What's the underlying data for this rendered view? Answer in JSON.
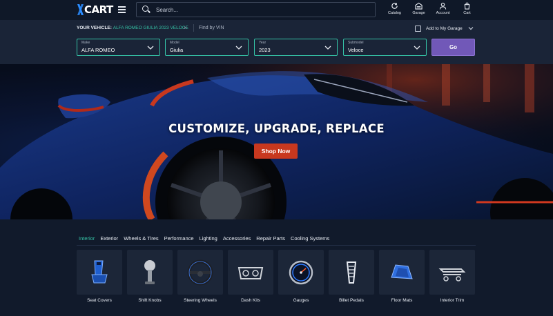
{
  "header": {
    "logo_text": "CART",
    "search_placeholder": "Search...",
    "nav": [
      {
        "label": "Catalog",
        "icon": "catalog-icon"
      },
      {
        "label": "Garage",
        "icon": "garage-icon"
      },
      {
        "label": "Account",
        "icon": "account-icon"
      },
      {
        "label": "Cart",
        "icon": "cart-icon"
      }
    ]
  },
  "vehicle": {
    "your_vehicle_label": "YOUR VEHICLE:",
    "your_vehicle_value": "ALFA ROMEO GIULIA 2023 VELOCE",
    "clear_symbol": "×",
    "find_by_vin": "Find by VIN",
    "add_to_garage": "Add to My Garage",
    "selects": [
      {
        "label": "Make",
        "value": "ALFA ROMEO"
      },
      {
        "label": "Model",
        "value": "Giulia"
      },
      {
        "label": "Year",
        "value": "2023"
      },
      {
        "label": "Submodel",
        "value": "Veloce"
      }
    ],
    "go_label": "Go"
  },
  "hero": {
    "title": "CUSTOMIZE, UPGRADE, REPLACE",
    "cta": "Shop Now"
  },
  "tabs": [
    {
      "label": "Interior",
      "active": true
    },
    {
      "label": "Exterior"
    },
    {
      "label": "Wheels & Tires"
    },
    {
      "label": "Performance"
    },
    {
      "label": "Lighting"
    },
    {
      "label": "Accessories"
    },
    {
      "label": "Repair Parts"
    },
    {
      "label": "Cooling Systems"
    }
  ],
  "products": [
    {
      "label": "Seat Covers",
      "icon": "seat-cover-icon"
    },
    {
      "label": "Shift Knobs",
      "icon": "shift-knob-icon"
    },
    {
      "label": "Steering Wheels",
      "icon": "steering-wheel-icon"
    },
    {
      "label": "Dash Kits",
      "icon": "dash-kit-icon"
    },
    {
      "label": "Gauges",
      "icon": "gauge-icon"
    },
    {
      "label": "Billet Pedals",
      "icon": "pedal-icon"
    },
    {
      "label": "Floor Mats",
      "icon": "floor-mat-icon"
    },
    {
      "label": "Interior Trim",
      "icon": "interior-trim-icon"
    }
  ],
  "colors": {
    "accent": "#35c2a6",
    "go_button": "#7158b8",
    "cta": "#c8381f",
    "logo_mark": "#2a8cff"
  }
}
